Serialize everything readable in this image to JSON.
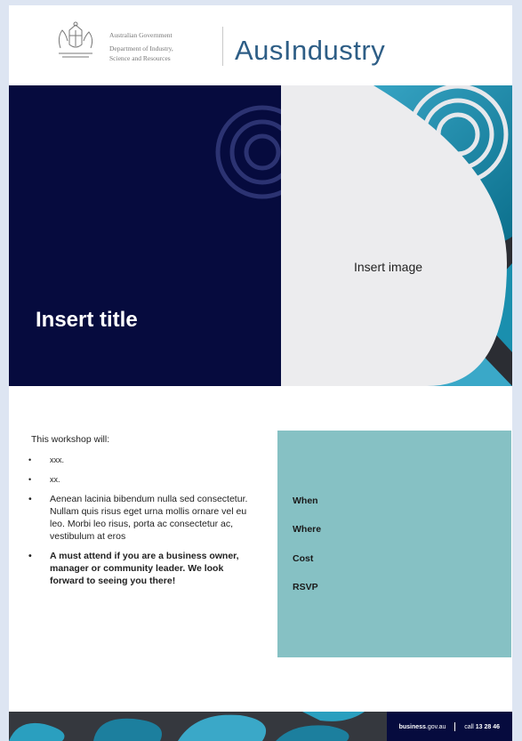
{
  "header": {
    "govt_lines": [
      "Australian Government",
      "Department of Industry,",
      "Science and Resources"
    ],
    "brand": "AusIndustry"
  },
  "hero": {
    "title": "Insert title",
    "image_placeholder": "Insert image"
  },
  "content": {
    "intro": "This workshop will:",
    "bullet_char": "•",
    "bullets": [
      "xxx.",
      "xx.",
      "Aenean lacinia bibendum nulla sed consectetur. Nullam quis risus eget urna mollis ornare vel eu leo. Morbi leo risus, porta ac consectetur ac, vestibulum at eros",
      "A must attend if you are a business owner, manager or community leader. We look forward to seeing you there!"
    ]
  },
  "info_box": {
    "when": "When",
    "where": "Where",
    "cost": "Cost",
    "rsvp": "RSVP"
  },
  "footer": {
    "site_bold": "business",
    "site_rest": ".gov.au",
    "call_prefix": "call",
    "phone": "13 28 46"
  },
  "colors": {
    "navy": "#060b3e",
    "teal_box": "#86c1c4",
    "brand_blue": "#2e5e86"
  }
}
